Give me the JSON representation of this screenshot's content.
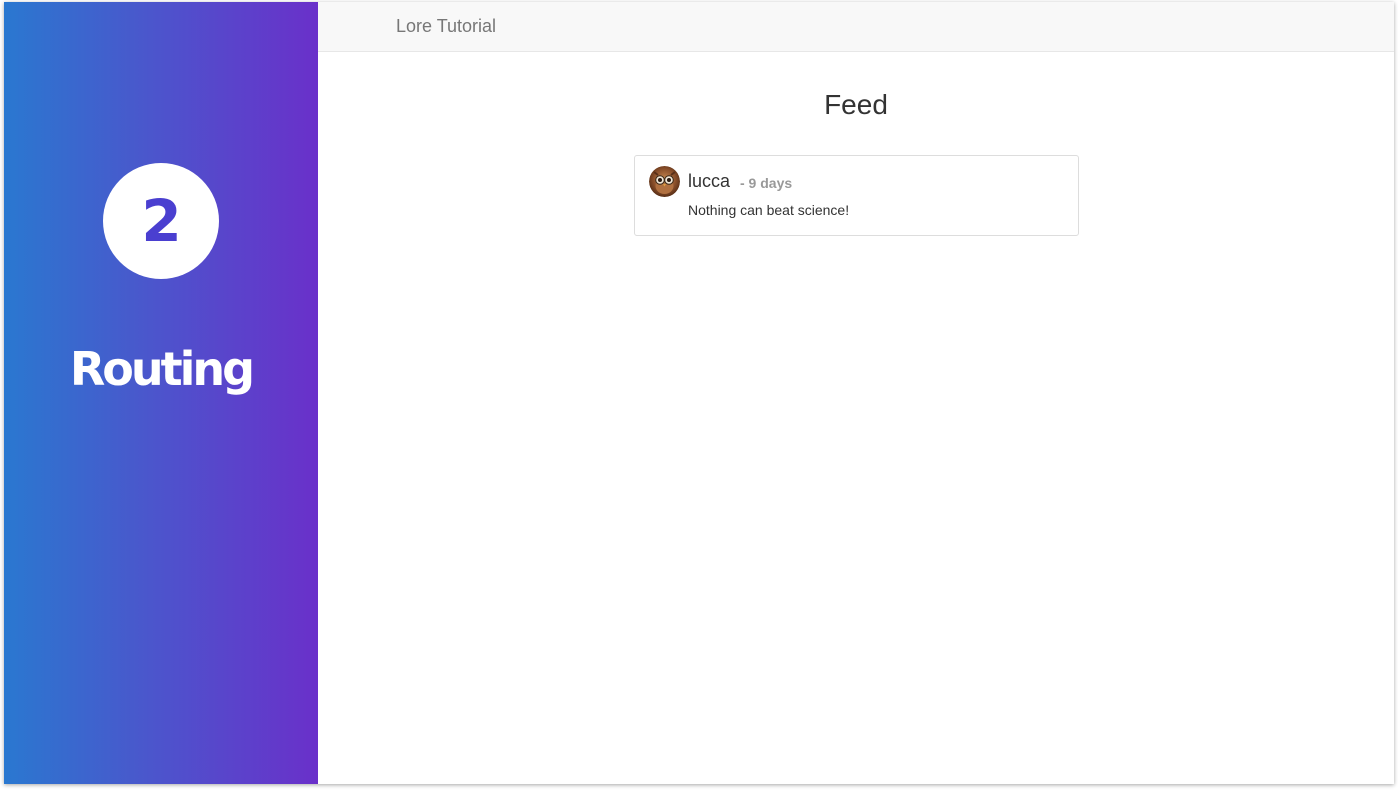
{
  "sidebar": {
    "step_number": "2",
    "title": "Routing"
  },
  "navbar": {
    "brand": "Lore Tutorial"
  },
  "feed": {
    "title": "Feed",
    "tweets": [
      {
        "author": "lucca",
        "time": "- 9 days",
        "text": "Nothing can beat science!",
        "avatar_icon": "owl-avatar-icon"
      }
    ]
  },
  "colors": {
    "gradient_start": "#2a78d0",
    "gradient_end": "#6a30ca",
    "navbar_bg": "#f8f8f8",
    "brand_text": "#777777"
  }
}
